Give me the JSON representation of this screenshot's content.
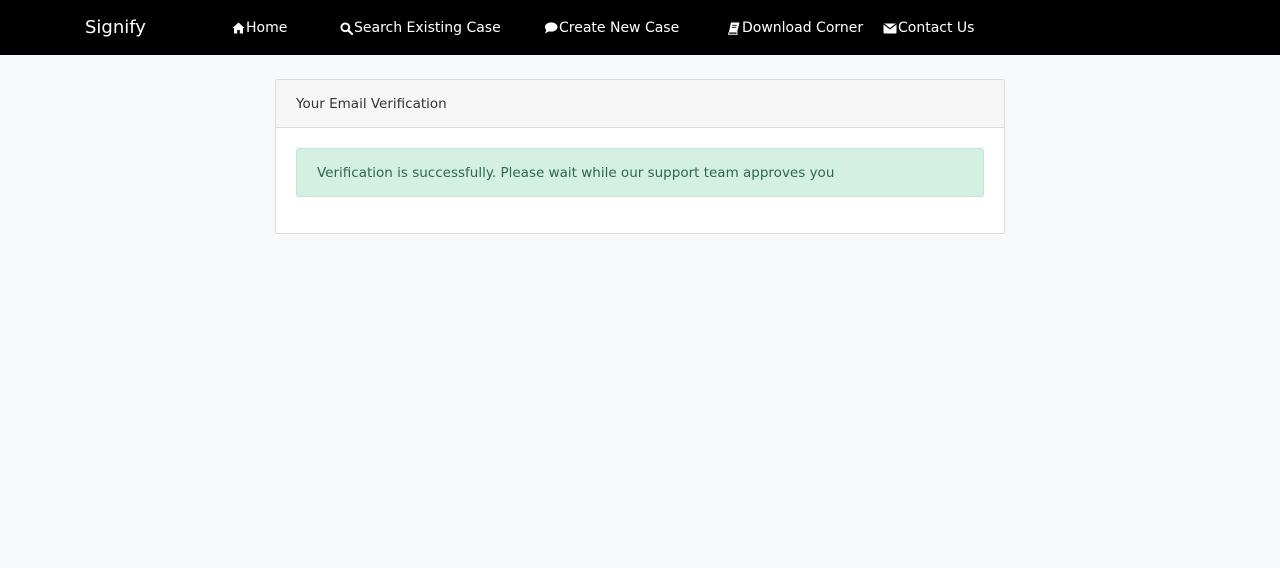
{
  "navbar": {
    "brand": "Signify",
    "items": [
      {
        "label": "Home",
        "icon": "home-icon"
      },
      {
        "label": "Search Existing Case",
        "icon": "search-icon"
      },
      {
        "label": "Create New Case",
        "icon": "comment-icon"
      },
      {
        "label": "Download Corner",
        "icon": "book-icon"
      },
      {
        "label": "Contact Us",
        "icon": "envelope-icon"
      }
    ]
  },
  "card": {
    "title": "Your Email Verification",
    "alert": "Verification is successfully. Please wait while our support team approves you"
  },
  "colors": {
    "navbar_bg": "#000000",
    "page_bg": "#f8f9fb",
    "alert_bg": "#d4f0e2",
    "alert_text": "#2f6650"
  }
}
